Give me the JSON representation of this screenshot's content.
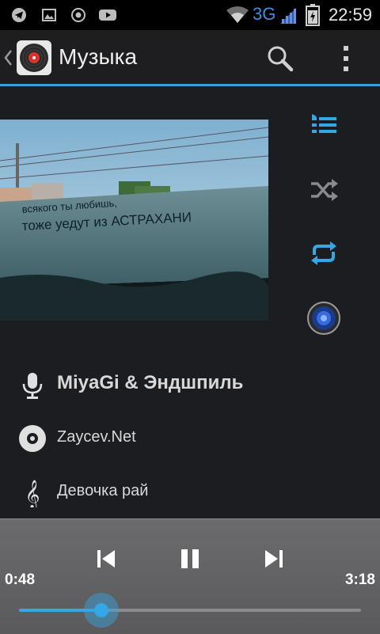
{
  "status_bar": {
    "network": "3G",
    "time": "22:59",
    "icons": [
      "telegram-icon",
      "image-notification-icon",
      "record-icon",
      "youtube-icon",
      "wifi-icon",
      "signal-icon",
      "battery-icon"
    ]
  },
  "action_bar": {
    "title": "Музыка",
    "icons": [
      "back-chevron-icon",
      "app-logo-icon",
      "search-icon",
      "overflow-menu-icon"
    ]
  },
  "side_controls": [
    "playlist-icon",
    "shuffle-icon",
    "repeat-icon",
    "equalizer-speaker-icon"
  ],
  "track": {
    "artist": "MiyaGi & Эндшпиль",
    "album": "Zaycev.Net",
    "title": "Девочка рай"
  },
  "player": {
    "elapsed": "0:48",
    "duration": "3:18",
    "progress_fraction": 0.24,
    "icons": [
      "previous-icon",
      "pause-icon",
      "next-icon"
    ]
  },
  "colors": {
    "accent": "#35a7e5",
    "shuffle_inactive": "#8a8a8a",
    "background": "#1c1d20",
    "player_panel": "#636365"
  },
  "cover_art": {
    "graffiti_line1": "всякого ты любишь,",
    "graffiti_line2": "тоже уедут из АСТРАХАНИ"
  }
}
